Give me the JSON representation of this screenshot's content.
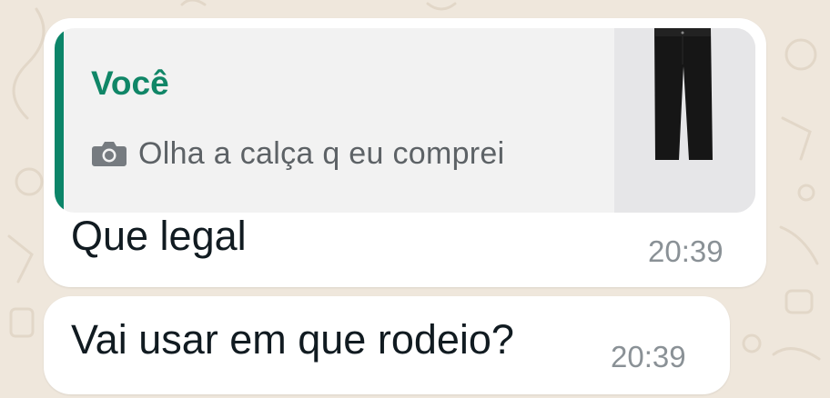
{
  "colors": {
    "wallpaper": "#efe7dc",
    "bubble": "#ffffff",
    "quote_background": "#f2f2f2",
    "quote_accent": "#0c8569",
    "author": "#108667",
    "message_text": "#111b21",
    "timestamp": "#8a9196"
  },
  "messages": [
    {
      "reply": {
        "author": "Você",
        "media_icon": "camera-icon",
        "text": "Olha a calça q eu comprei",
        "thumbnail": "black-jeans-photo"
      },
      "text": "Que legal",
      "time": "20:39"
    },
    {
      "text": "Vai usar em que rodeio?",
      "time": "20:39"
    }
  ]
}
